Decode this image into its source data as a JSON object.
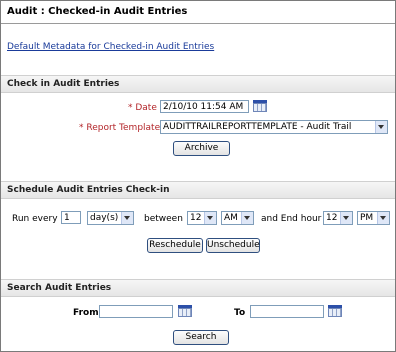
{
  "title": "Audit : Checked-in Audit Entries",
  "default_metadata_link": "Default Metadata for Checked-in Audit Entries",
  "check_in": {
    "header": "Check in Audit Entries",
    "date_label": "* Date",
    "date_value": "2/10/10 11:54 AM",
    "report_label": "* Report Template",
    "report_value": "AUDITTRAILREPORTTEMPLATE - Audit Trail",
    "archive_button": "Archive"
  },
  "schedule": {
    "header": "Schedule Audit Entries Check-in",
    "run_every_label": "Run every",
    "run_every_value": "1",
    "unit_value": "day(s)",
    "between_label": "between",
    "start_hour": "12",
    "start_ampm": "AM",
    "and_end_hour_label": "and  End hour",
    "end_hour": "12",
    "end_ampm": "PM",
    "reschedule_button": "Reschedule",
    "unschedule_button": "Unschedule"
  },
  "search": {
    "header": "Search Audit Entries",
    "from_label": "From",
    "from_value": "",
    "to_label": "To",
    "to_value": "",
    "search_button": "Search"
  }
}
